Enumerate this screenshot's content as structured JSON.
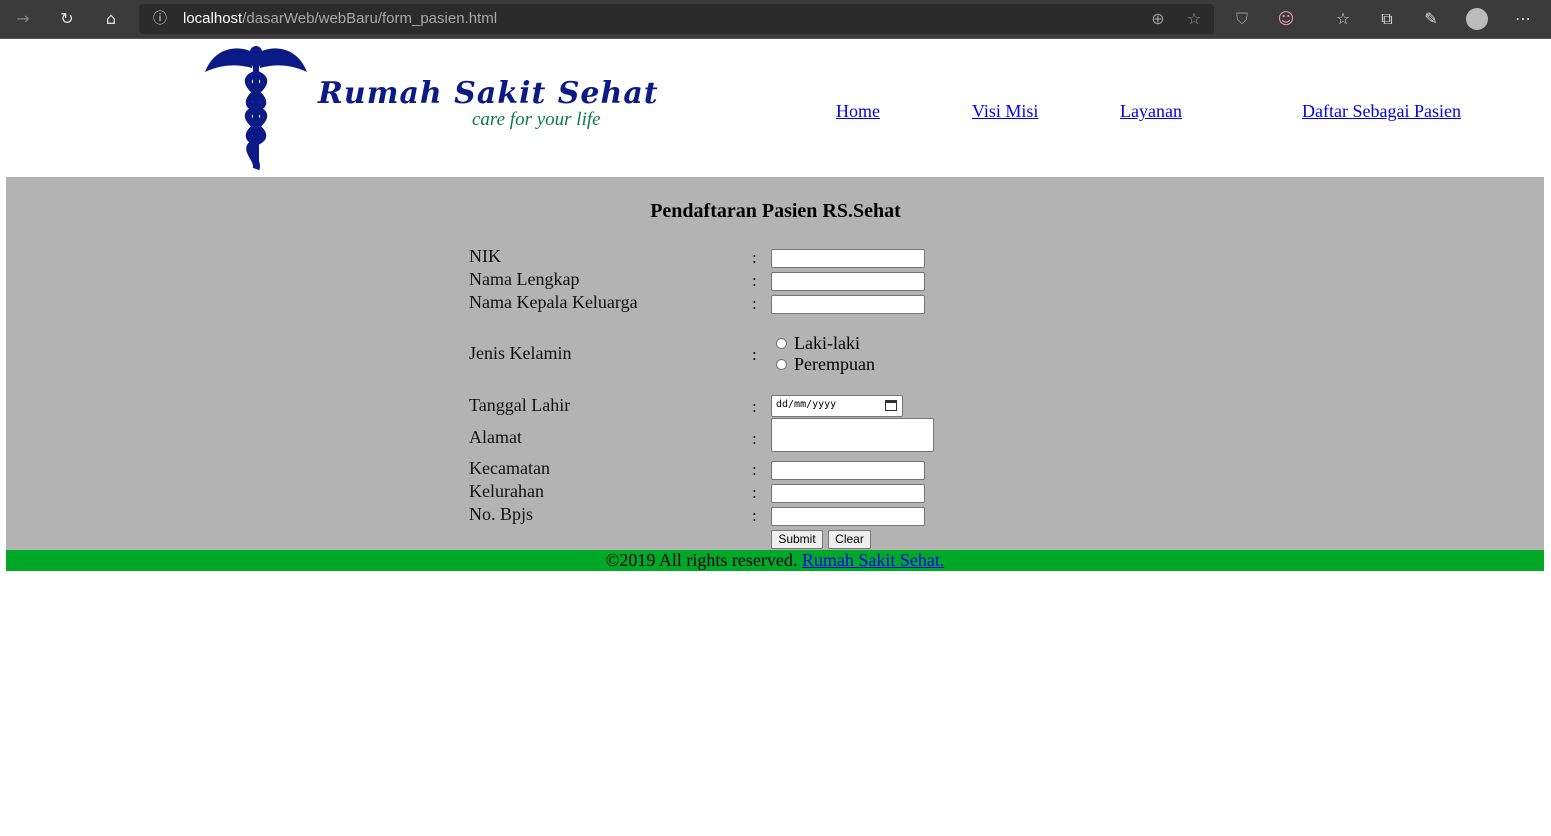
{
  "browser": {
    "url_host": "localhost",
    "url_path": "/dasarWeb/webBaru/form_pasien.html"
  },
  "logo": {
    "title": "Rumah Sakit Sehat",
    "tagline": "care for your life"
  },
  "nav": [
    "Home",
    "Visi Misi",
    "Layanan",
    "Daftar Sebagai Pasien"
  ],
  "form": {
    "title": "Pendaftaran Pasien RS.Sehat",
    "colon": ":",
    "labels": {
      "nik": "NIK",
      "nama": "Nama Lengkap",
      "kepala": "Nama Kepala Keluarga",
      "jk": "Jenis Kelamin",
      "tgl": "Tanggal Lahir",
      "alamat": "Alamat",
      "kec": "Kecamatan",
      "kel": "Kelurahan",
      "bpjs": "No. Bpjs"
    },
    "gender_options": [
      "Laki-laki",
      "Perempuan"
    ],
    "date_placeholder": "dd/mm/yyyy",
    "submit": "Submit",
    "clear": "Clear"
  },
  "footer": {
    "text": "©2019 All rights reserved. ",
    "link": "Rumah Sakit Sehat."
  }
}
